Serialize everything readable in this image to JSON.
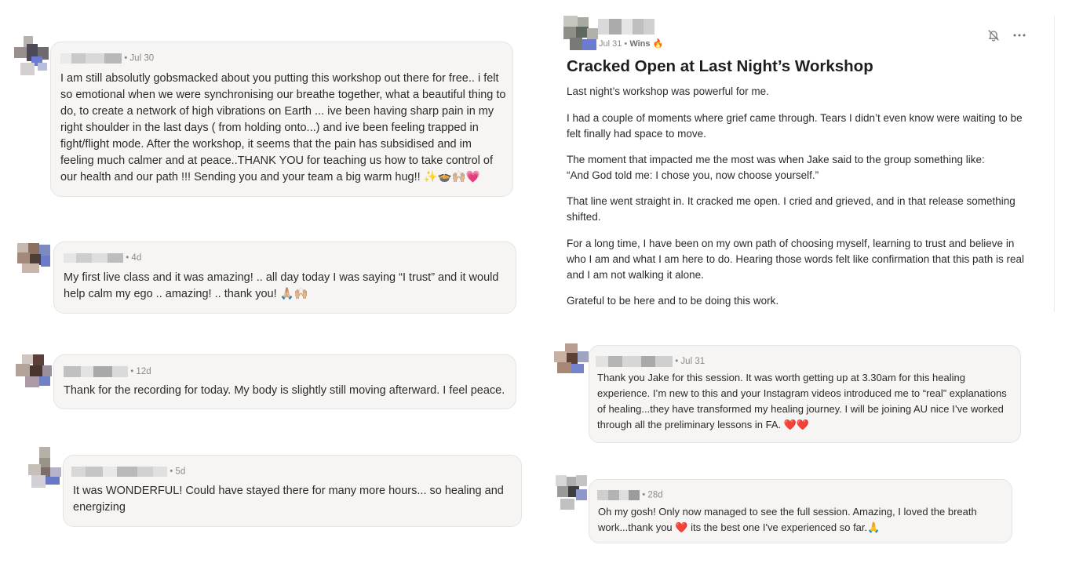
{
  "left_comments": [
    {
      "date": "• Jul 30",
      "text": "I am still absolutly gobsmacked about you putting this workshop out there for free.. i felt so emotional when we were synchronising our breathe together, what a beautiful thing to do, to create a network of high vibrations on Earth ... ive been having sharp pain in my right shoulder in the last days ( from holding onto...) and ive been feeling trapped in fight/flight mode. After the workshop, it seems that the pain has subsidised and im feeling much calmer and at peace..THANK YOU for teaching us how to take control of our health and our path !!! Sending you and your team a big warm hug!! ✨🍲🙌🏼💗"
    },
    {
      "date": "• 4d",
      "text": "My first live class and it was amazing! .. all day today I was saying “I trust” and it would help calm my ego .. amazing! .. thank you! 🙏🏼🙌🏼"
    },
    {
      "date": "• 12d",
      "text": "Thank for the recording for today. My body is slightly still moving afterward. I feel peace."
    },
    {
      "date": "• 5d",
      "text": "It was WONDERFUL! Could have stayed there for many more hours... so healing and energizing"
    }
  ],
  "post": {
    "date": "Jul 31 • ",
    "category": "Wins 🔥",
    "title": "Cracked Open at Last Night’s Workshop",
    "paragraphs": [
      "Last night’s workshop was powerful for me.",
      "I had a couple of moments where grief came through. Tears I didn’t even know were waiting to be felt finally had space to move.",
      "The moment that impacted me the most was when Jake said to the group something like:",
      "“And God told me: I chose you, now choose yourself.”",
      "That line went straight in. It cracked me open. I cried and grieved, and in that release something shifted.",
      "For a long time, I have been on my own path of choosing myself, learning to trust and believe in who I am and what I am here to do. Hearing those words felt like confirmation that this path is real and I am not walking it alone.",
      "Grateful to be here and to be doing this work."
    ],
    "icons": {
      "bell": "bell-off-icon",
      "more": "more-horizontal-icon"
    }
  },
  "right_comments": [
    {
      "date": "• Jul 31",
      "text": "Thank you Jake for this session. It was worth getting up at 3.30am for this healing experience. I’m new to this and your Instagram videos introduced me to “real” explanations of healing...they have transformed my healing journey. I will be joining AU nice I’ve worked through all the preliminary lessons in FA. ❤️❤️"
    },
    {
      "date": "• 28d",
      "text": "Oh my gosh! Only now managed to see the full session. Amazing, I loved the breath work...thank you ❤️ its the best one I've experienced so far.🙏"
    }
  ],
  "colors": {
    "bubble_bg": "#f6f5f3",
    "bubble_border": "#e6e4e0",
    "meta": "#8a8a8a",
    "text": "#2b2b2b"
  }
}
